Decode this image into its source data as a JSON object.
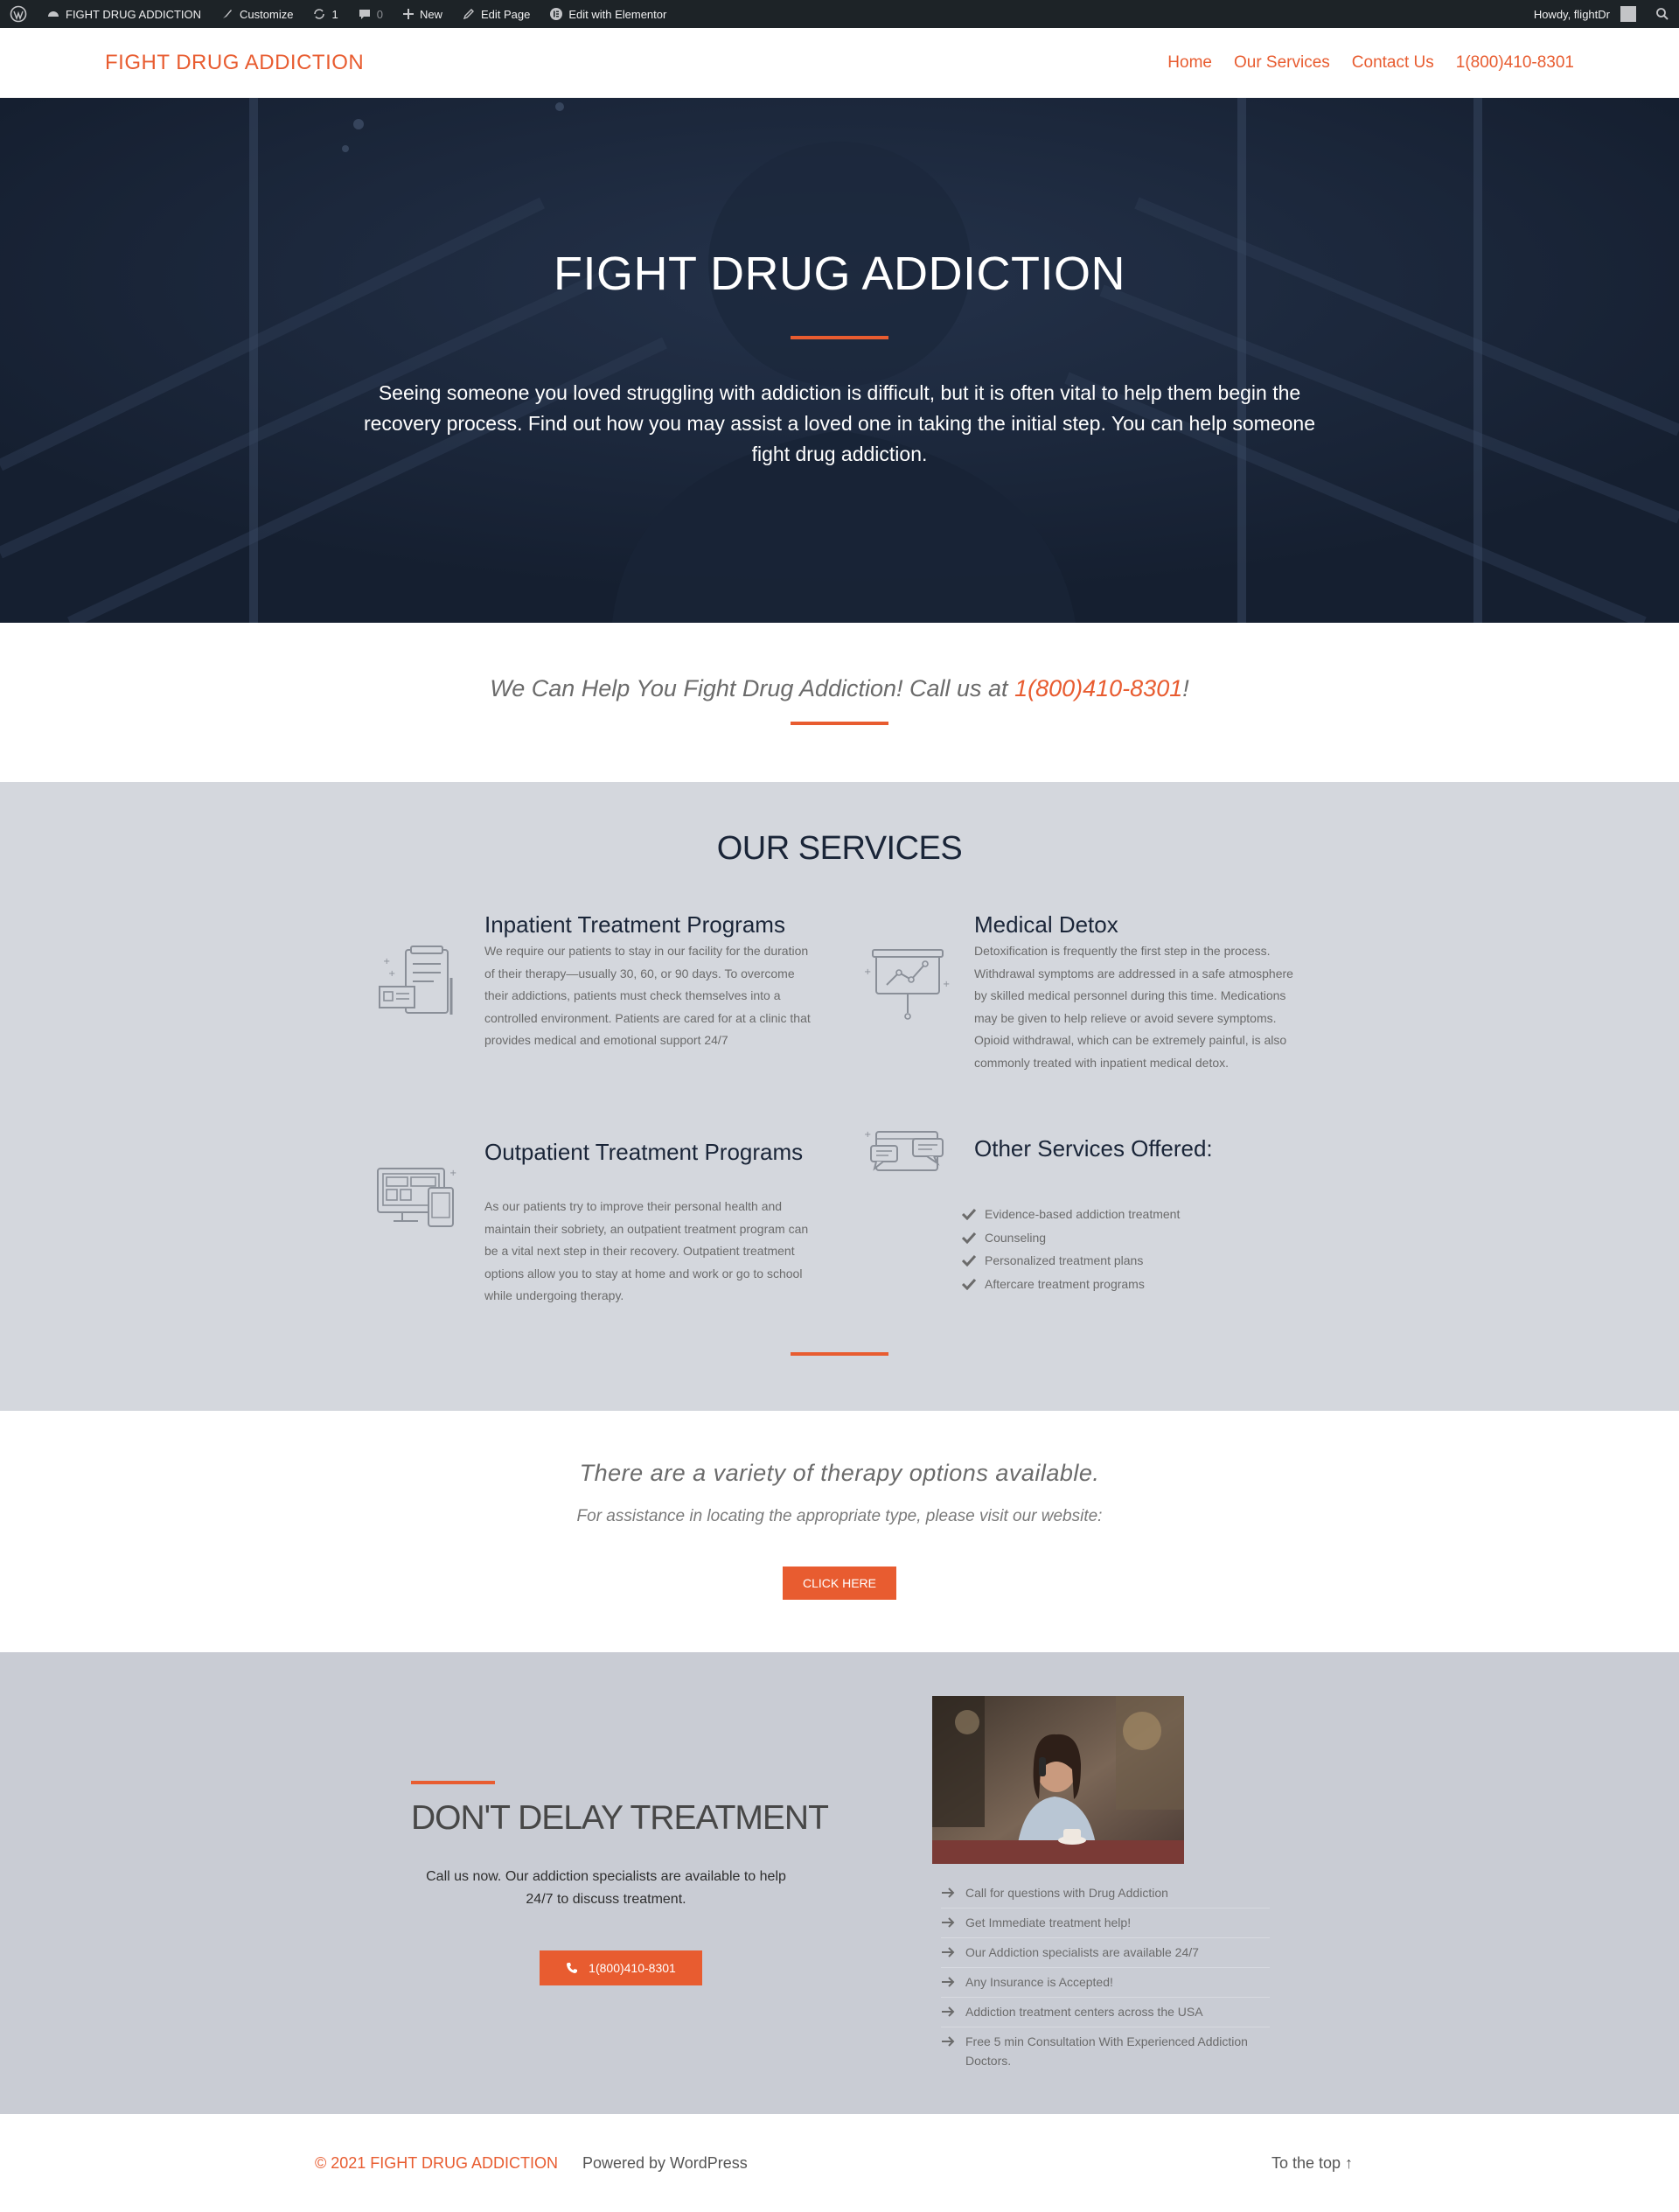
{
  "admin_bar": {
    "site_name": "FIGHT DRUG ADDICTION",
    "customize": "Customize",
    "updates_count": "1",
    "comments_count": "0",
    "new": "New",
    "edit_page": "Edit Page",
    "edit_elementor": "Edit with Elementor",
    "howdy": "Howdy, flightDr"
  },
  "header": {
    "site_title": "FIGHT DRUG ADDICTION",
    "nav": [
      "Home",
      "Our Services",
      "Contact Us",
      "1(800)410-8301"
    ]
  },
  "hero": {
    "title": "FIGHT DRUG ADDICTION",
    "text": "Seeing someone you loved struggling with addiction is difficult, but it is often vital to help them begin the recovery process. Find out how you may assist a loved one in taking the initial step. You can help someone fight drug addiction."
  },
  "callout": {
    "text": "We Can Help You Fight Drug Addiction! Call us at ",
    "phone": "1(800)410-8301",
    "suffix": "!"
  },
  "services": {
    "heading": "OUR SERVICES",
    "inpatient": {
      "title": "Inpatient Treatment Programs",
      "text": "We require our patients to stay in our facility for the duration of their therapy—usually 30, 60, or 90 days. To overcome their addictions, patients must check themselves into a controlled environment. Patients are cared for at a clinic that provides medical and emotional support 24/7"
    },
    "detox": {
      "title": "Medical Detox",
      "text": "Detoxification is frequently the first step in the process. Withdrawal symptoms are addressed in a safe atmosphere by skilled medical personnel during this time. Medications may be given to help relieve or avoid severe symptoms. Opioid withdrawal, which can be extremely painful, is also commonly treated with inpatient medical detox."
    },
    "outpatient": {
      "title": "Outpatient Treatment Programs",
      "text": "As our patients try to improve their personal health and maintain their sobriety, an outpatient treatment program can be a vital next step in their recovery. Outpatient treatment options allow you to stay at home and work or go to school while undergoing therapy."
    },
    "other": {
      "title": "Other Services Offered:",
      "items": [
        "Evidence-based addiction treatment",
        "Counseling",
        "Personalized treatment plans",
        "Aftercare treatment programs"
      ]
    }
  },
  "therapy": {
    "title": "There are a variety of therapy options available.",
    "subtitle": "For assistance in locating the appropriate type, please visit our website:",
    "button": "CLICK HERE"
  },
  "delay": {
    "heading": "DON'T DELAY TREATMENT",
    "text": "Call us now. Our addiction specialists are available to help 24/7 to discuss treatment.",
    "button": "1(800)410-8301",
    "list": [
      "Call for questions with Drug Addiction",
      "Get Immediate treatment help!",
      "Our Addiction specialists are available 24/7",
      "Any Insurance is Accepted!",
      "Addiction treatment centers across the USA",
      "Free 5 min Consultation With Experienced Addiction Doctors."
    ]
  },
  "footer": {
    "copyright": "© 2021 FIGHT DRUG ADDICTION",
    "powered": "Powered by WordPress",
    "to_top": "To the top ↑"
  },
  "colors": {
    "accent": "#e85c30",
    "navy": "#1a2538",
    "services_bg": "#d4d7dd",
    "delay_bg": "#c9ccd4"
  },
  "icons": [
    "wordpress-icon",
    "dashboard-icon",
    "brush-icon",
    "refresh-icon",
    "comment-icon",
    "plus-icon",
    "pencil-icon",
    "elementor-icon",
    "search-icon",
    "clipboard-icon",
    "chart-board-icon",
    "devices-icon",
    "chat-bubbles-icon",
    "check-icon",
    "phone-icon",
    "arrow-right-icon"
  ]
}
